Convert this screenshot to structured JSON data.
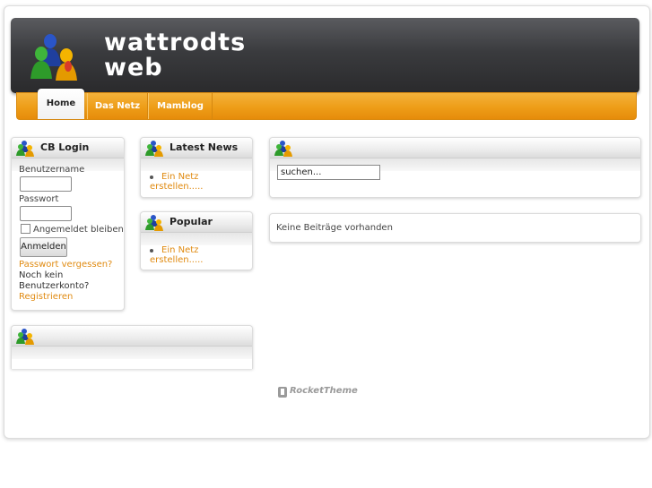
{
  "site": {
    "logo_line1": "wattrodts",
    "logo_line2": "web"
  },
  "nav": {
    "items": [
      "Home",
      "Das Netz",
      "Mamblog"
    ]
  },
  "cb_login": {
    "title": "CB Login",
    "username_label": "Benutzername",
    "password_label": "Passwort",
    "remember_label": "Angemeldet bleiben",
    "login_button": "Anmelden",
    "forgot_link": "Passwort vergessen?",
    "no_account_line1": "Noch kein",
    "no_account_line2": "Benutzerkonto?",
    "register_link": "Registrieren"
  },
  "latest_news": {
    "title": "Latest News",
    "items": [
      "Ein Netz erstellen....."
    ]
  },
  "popular": {
    "title": "Popular",
    "items": [
      "Ein Netz erstellen....."
    ]
  },
  "search": {
    "value": "suchen..."
  },
  "content": {
    "empty_text": "Keine Beiträge vorhanden"
  },
  "footer": {
    "brand": "RocketTheme"
  },
  "colors": {
    "accent": "#ee9d18",
    "header_dark": "#3a3b3e",
    "link": "#e08a10"
  },
  "icons": {
    "module_icon": "users-icon",
    "logo_icon": "people-icon"
  }
}
